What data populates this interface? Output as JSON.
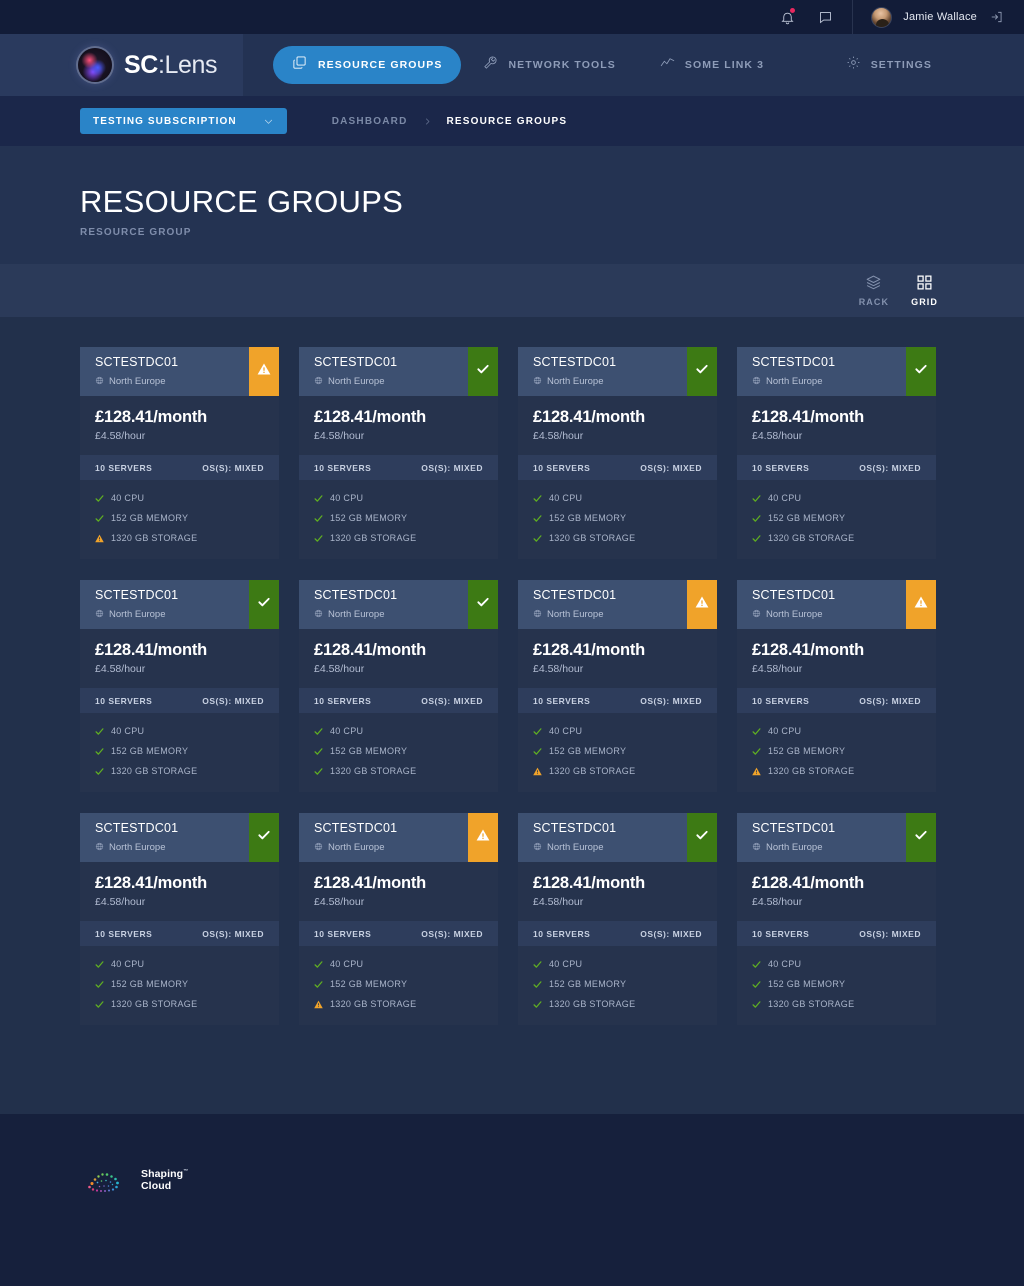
{
  "topbar": {
    "notifications_icon": "bell-icon",
    "has_notification": true,
    "messages_icon": "chat-icon",
    "user_name": "Jamie Wallace",
    "logout_icon": "logout-icon"
  },
  "brand": {
    "name_bold": "SC",
    "name_light": ":Lens",
    "logo_icon": "sclens-orb-logo"
  },
  "nav": {
    "items": [
      {
        "label": "RESOURCE GROUPS",
        "icon": "copy-icon",
        "active": true
      },
      {
        "label": "NETWORK TOOLS",
        "icon": "wrench-icon",
        "active": false
      },
      {
        "label": "SOME LINK 3",
        "icon": "trend-line-icon",
        "active": false
      }
    ],
    "settings": {
      "label": "SETTINGS",
      "icon": "gear-icon"
    }
  },
  "subnav": {
    "subscription_label": "TESTING SUBSCRIPTION",
    "subscription_icon": "chevron-down-icon",
    "breadcrumbs": [
      {
        "label": "DASHBOARD",
        "active": false
      },
      {
        "label": "RESOURCE GROUPS",
        "active": true
      }
    ]
  },
  "page": {
    "title": "RESOURCE GROUPS",
    "subtitle": "RESOURCE GROUP"
  },
  "toolbar": {
    "views": [
      {
        "label": "RACK",
        "icon": "layers-icon",
        "active": false
      },
      {
        "label": "GRID",
        "icon": "grid-icon",
        "active": true
      }
    ]
  },
  "colors": {
    "accent_blue": "#2a84c8",
    "status_ok": "#3d7a14",
    "status_warning": "#f0a32a",
    "spec_ok": "#5fae22",
    "spec_warning": "#f0a32a"
  },
  "cards": [
    {
      "title": "SCTESTDC01",
      "location": "North Europe",
      "location_icon": "globe-icon",
      "status": "warning",
      "status_icon": "warning-icon",
      "price_monthly": "£128.41/month",
      "price_hourly": "£4.58/hour",
      "servers": "10 SERVERS",
      "os": "OS(S): MIXED",
      "specs": [
        {
          "label": "40 CPU",
          "state": "ok"
        },
        {
          "label": "152 GB MEMORY",
          "state": "ok"
        },
        {
          "label": "1320 GB STORAGE",
          "state": "warning"
        }
      ]
    },
    {
      "title": "SCTESTDC01",
      "location": "North Europe",
      "location_icon": "globe-icon",
      "status": "ok",
      "status_icon": "check-icon",
      "price_monthly": "£128.41/month",
      "price_hourly": "£4.58/hour",
      "servers": "10 SERVERS",
      "os": "OS(S): MIXED",
      "specs": [
        {
          "label": "40 CPU",
          "state": "ok"
        },
        {
          "label": "152 GB MEMORY",
          "state": "ok"
        },
        {
          "label": "1320 GB STORAGE",
          "state": "ok"
        }
      ]
    },
    {
      "title": "SCTESTDC01",
      "location": "North Europe",
      "location_icon": "globe-icon",
      "status": "ok",
      "status_icon": "check-icon",
      "price_monthly": "£128.41/month",
      "price_hourly": "£4.58/hour",
      "servers": "10 SERVERS",
      "os": "OS(S): MIXED",
      "specs": [
        {
          "label": "40 CPU",
          "state": "ok"
        },
        {
          "label": "152 GB MEMORY",
          "state": "ok"
        },
        {
          "label": "1320 GB STORAGE",
          "state": "ok"
        }
      ]
    },
    {
      "title": "SCTESTDC01",
      "location": "North Europe",
      "location_icon": "globe-icon",
      "status": "ok",
      "status_icon": "check-icon",
      "price_monthly": "£128.41/month",
      "price_hourly": "£4.58/hour",
      "servers": "10 SERVERS",
      "os": "OS(S): MIXED",
      "specs": [
        {
          "label": "40 CPU",
          "state": "ok"
        },
        {
          "label": "152 GB MEMORY",
          "state": "ok"
        },
        {
          "label": "1320 GB STORAGE",
          "state": "ok"
        }
      ]
    },
    {
      "title": "SCTESTDC01",
      "location": "North Europe",
      "location_icon": "globe-icon",
      "status": "ok",
      "status_icon": "check-icon",
      "price_monthly": "£128.41/month",
      "price_hourly": "£4.58/hour",
      "servers": "10 SERVERS",
      "os": "OS(S): MIXED",
      "specs": [
        {
          "label": "40 CPU",
          "state": "ok"
        },
        {
          "label": "152 GB MEMORY",
          "state": "ok"
        },
        {
          "label": "1320 GB STORAGE",
          "state": "ok"
        }
      ]
    },
    {
      "title": "SCTESTDC01",
      "location": "North Europe",
      "location_icon": "globe-icon",
      "status": "ok",
      "status_icon": "check-icon",
      "price_monthly": "£128.41/month",
      "price_hourly": "£4.58/hour",
      "servers": "10 SERVERS",
      "os": "OS(S): MIXED",
      "specs": [
        {
          "label": "40 CPU",
          "state": "ok"
        },
        {
          "label": "152 GB MEMORY",
          "state": "ok"
        },
        {
          "label": "1320 GB STORAGE",
          "state": "ok"
        }
      ]
    },
    {
      "title": "SCTESTDC01",
      "location": "North Europe",
      "location_icon": "globe-icon",
      "status": "warning",
      "status_icon": "warning-icon",
      "price_monthly": "£128.41/month",
      "price_hourly": "£4.58/hour",
      "servers": "10 SERVERS",
      "os": "OS(S): MIXED",
      "specs": [
        {
          "label": "40 CPU",
          "state": "ok"
        },
        {
          "label": "152 GB MEMORY",
          "state": "ok"
        },
        {
          "label": "1320 GB STORAGE",
          "state": "warning"
        }
      ]
    },
    {
      "title": "SCTESTDC01",
      "location": "North Europe",
      "location_icon": "globe-icon",
      "status": "warning",
      "status_icon": "warning-icon",
      "price_monthly": "£128.41/month",
      "price_hourly": "£4.58/hour",
      "servers": "10 SERVERS",
      "os": "OS(S): MIXED",
      "specs": [
        {
          "label": "40 CPU",
          "state": "ok"
        },
        {
          "label": "152 GB MEMORY",
          "state": "ok"
        },
        {
          "label": "1320 GB STORAGE",
          "state": "warning"
        }
      ]
    },
    {
      "title": "SCTESTDC01",
      "location": "North Europe",
      "location_icon": "globe-icon",
      "status": "ok",
      "status_icon": "check-icon",
      "price_monthly": "£128.41/month",
      "price_hourly": "£4.58/hour",
      "servers": "10 SERVERS",
      "os": "OS(S): MIXED",
      "specs": [
        {
          "label": "40 CPU",
          "state": "ok"
        },
        {
          "label": "152 GB MEMORY",
          "state": "ok"
        },
        {
          "label": "1320 GB STORAGE",
          "state": "ok"
        }
      ]
    },
    {
      "title": "SCTESTDC01",
      "location": "North Europe",
      "location_icon": "globe-icon",
      "status": "warning",
      "status_icon": "warning-icon",
      "price_monthly": "£128.41/month",
      "price_hourly": "£4.58/hour",
      "servers": "10 SERVERS",
      "os": "OS(S): MIXED",
      "specs": [
        {
          "label": "40 CPU",
          "state": "ok"
        },
        {
          "label": "152 GB MEMORY",
          "state": "ok"
        },
        {
          "label": "1320 GB STORAGE",
          "state": "warning"
        }
      ]
    },
    {
      "title": "SCTESTDC01",
      "location": "North Europe",
      "location_icon": "globe-icon",
      "status": "ok",
      "status_icon": "check-icon",
      "price_monthly": "£128.41/month",
      "price_hourly": "£4.58/hour",
      "servers": "10 SERVERS",
      "os": "OS(S): MIXED",
      "specs": [
        {
          "label": "40 CPU",
          "state": "ok"
        },
        {
          "label": "152 GB MEMORY",
          "state": "ok"
        },
        {
          "label": "1320 GB STORAGE",
          "state": "ok"
        }
      ]
    },
    {
      "title": "SCTESTDC01",
      "location": "North Europe",
      "location_icon": "globe-icon",
      "status": "ok",
      "status_icon": "check-icon",
      "price_monthly": "£128.41/month",
      "price_hourly": "£4.58/hour",
      "servers": "10 SERVERS",
      "os": "OS(S): MIXED",
      "specs": [
        {
          "label": "40 CPU",
          "state": "ok"
        },
        {
          "label": "152 GB MEMORY",
          "state": "ok"
        },
        {
          "label": "1320 GB STORAGE",
          "state": "ok"
        }
      ]
    }
  ],
  "footer": {
    "logo_icon": "shaping-cloud-logo",
    "line1": "Shaping",
    "line2": "Cloud",
    "trademark": "™"
  }
}
